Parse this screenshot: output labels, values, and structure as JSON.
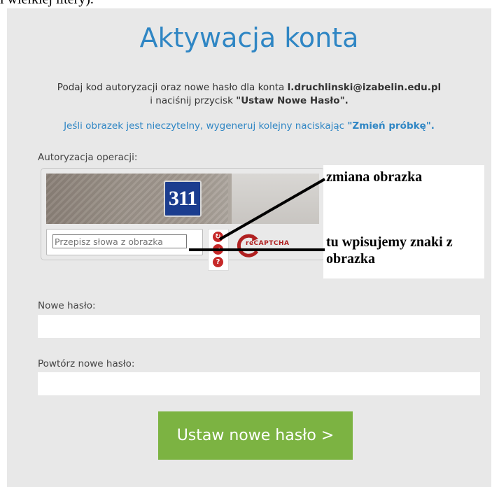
{
  "top_cut_text": "i wielkiej litery).",
  "title": "Aktywacja konta",
  "instruction": {
    "part1": "Podaj kod autoryzacji oraz nowe hasło dla konta ",
    "email": "l.druchlinski@izabelin.edu.pl",
    "part2": "i naciśnij przycisk ",
    "button_ref": "\"Ustaw Nowe Hasło\".",
    "hint1": "Jeśli obrazek jest nieczytelny, wygeneruj kolejny naciskając ",
    "hint_button": "\"Zmień próbkę\"."
  },
  "authorization": {
    "label": "Autoryzacja operacji:",
    "captcha_number": "311",
    "captcha_placeholder": "Przepisz słowa z obrazka",
    "brand": "reCAPTCHA"
  },
  "annotations": {
    "change_image": "zmiana obrazka",
    "type_here": "tu wpisujemy znaki z obrazka"
  },
  "new_password": {
    "label": "Nowe hasło:",
    "value": ""
  },
  "repeat_password": {
    "label": "Powtórz nowe hasło:",
    "value": ""
  },
  "submit_label": "Ustaw nowe hasło >",
  "colors": {
    "title": "#2f86c4",
    "submit": "#7cb342",
    "panel": "#e8e8e8"
  }
}
